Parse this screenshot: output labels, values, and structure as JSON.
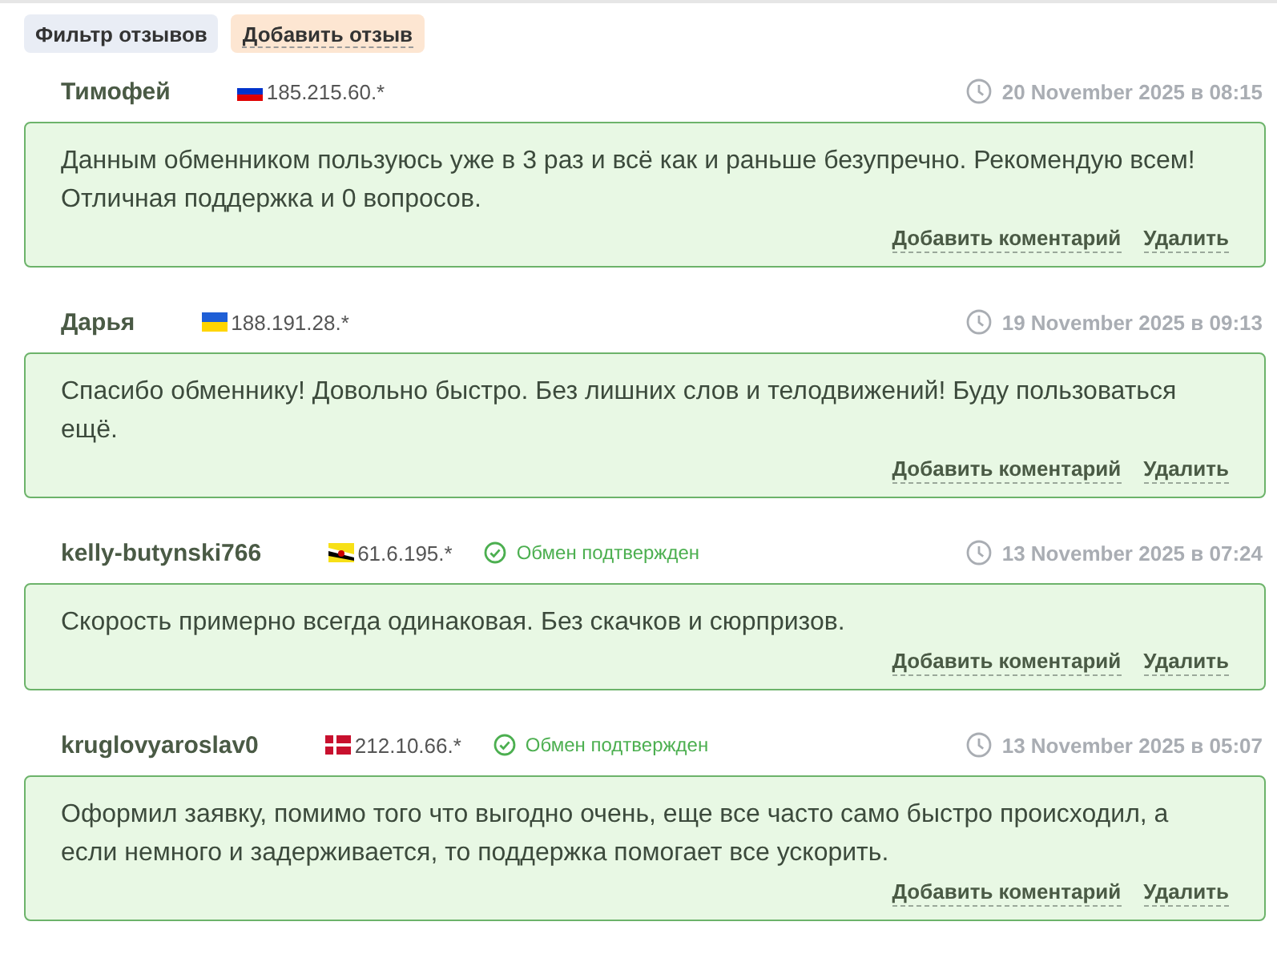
{
  "toolbar": [
    {
      "label": "Фильтр отзывов",
      "kind": "filter"
    },
    {
      "label": "Добавить отзыв",
      "kind": "add"
    }
  ],
  "reviews": [
    {
      "author": "Тимофей",
      "flag": {
        "kind": "ru"
      },
      "ip": "185.215.60.*",
      "verified": false,
      "date": "20 November 2025 в 08:15",
      "text": "Данным обменником пользуюсь уже в 3 раз и всё как и раньше безупречно. Рекомендую всем! Отличная поддержка и 0 вопросов.",
      "actions": [
        "Добавить коментарий",
        "Удалить"
      ]
    },
    {
      "author": "Дарья",
      "flag": {
        "kind": "ua"
      },
      "ip": "188.191.28.*",
      "verified": false,
      "date": "19 November 2025 в 09:13",
      "text": "Спасибо обменнику! Довольно быстро. Без лишних слов и телодвижений! Буду пользоваться ещё.",
      "actions": [
        "Добавить коментарий",
        "Удалить"
      ]
    },
    {
      "author": "kelly-butynski766",
      "flag": {
        "kind": "bn"
      },
      "ip": "61.6.195.*",
      "verified": true,
      "verified_label": "Обмен подтвержден",
      "date": "13 November 2025 в 07:24",
      "text": "Скорость примерно всегда одинаковая. Без скачков и сюрпризов.",
      "actions": [
        "Добавить коментарий",
        "Удалить"
      ]
    },
    {
      "author": "kruglovyaroslav0",
      "flag": {
        "kind": "dk"
      },
      "ip": "212.10.66.*",
      "verified": true,
      "verified_label": "Обмен подтвержден",
      "date": "13 November 2025 в 05:07",
      "text": "Оформил заявку, помимо того что выгодно очень, еще все часто само быстро происходил, а если немного и задерживается, то поддержка помогает все ускорить.",
      "actions": [
        "Добавить коментарий",
        "Удалить"
      ]
    }
  ]
}
